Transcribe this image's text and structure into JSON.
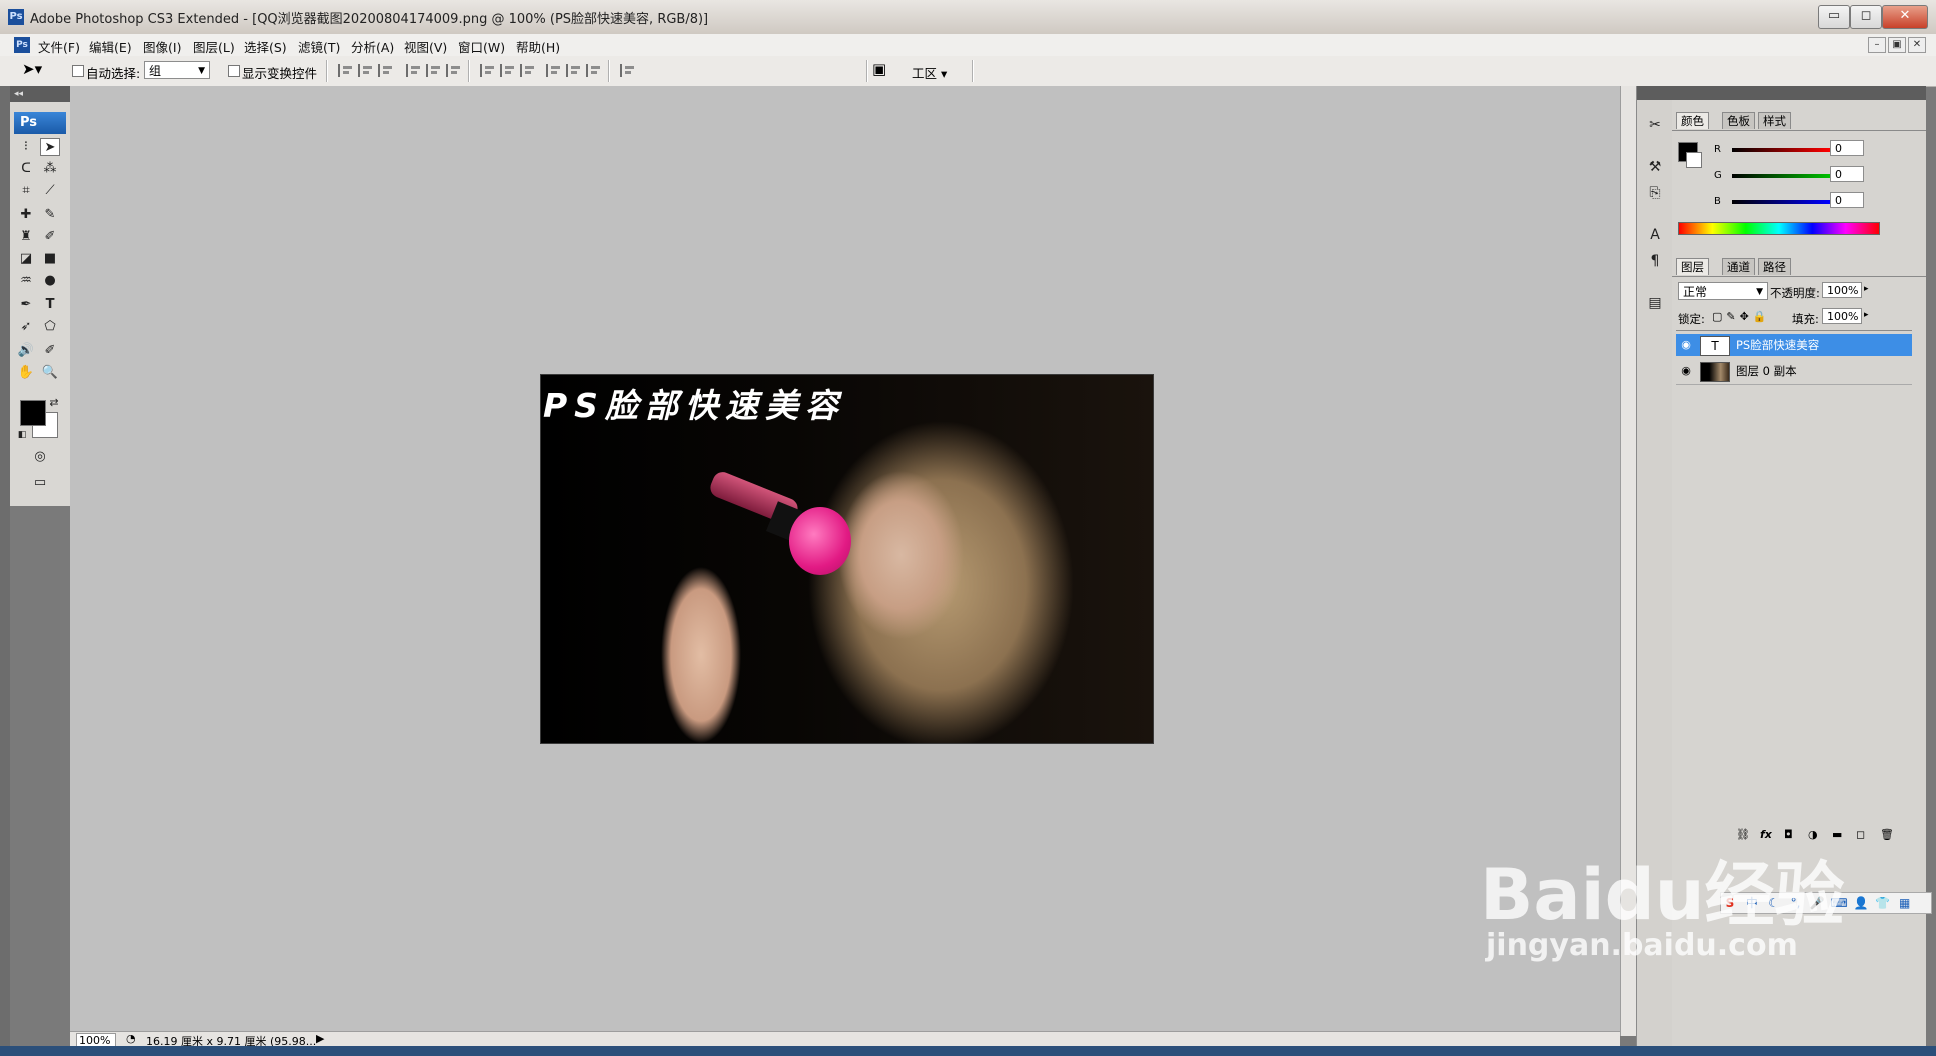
{
  "window": {
    "title": "Adobe Photoshop CS3 Extended - [QQ浏览器截图20200804174009.png @ 100% (PS脸部快速美容, RGB/8)]",
    "app_icon": "Ps",
    "controls": {
      "minimize": "▭",
      "maximize": "◻",
      "close": "✕"
    }
  },
  "menubar": {
    "items": [
      "文件(F)",
      "编辑(E)",
      "图像(I)",
      "图层(L)",
      "选择(S)",
      "滤镜(T)",
      "分析(A)",
      "视图(V)",
      "窗口(W)",
      "帮助(H)"
    ],
    "doc_controls": [
      "–",
      "▣",
      "✕"
    ]
  },
  "options": {
    "auto_select_label": "自动选择:",
    "auto_select_value": "组",
    "show_transform_label": "显示变换控件",
    "workspace_label": "工区"
  },
  "toolbox": {
    "logo": "Ps",
    "tools": [
      "move-icon",
      "marquee-icon",
      "lasso-icon",
      "magic-wand-icon",
      "crop-icon",
      "slice-icon",
      "healing-icon",
      "brush-icon",
      "stamp-icon",
      "history-brush-icon",
      "eraser-icon",
      "gradient-icon",
      "blur-icon",
      "dodge-icon",
      "pen-icon",
      "type-icon",
      "path-select-icon",
      "shape-icon",
      "notes-icon",
      "eyedropper-icon",
      "hand-icon",
      "zoom-icon"
    ]
  },
  "document": {
    "overlay_text": "PS脸部快速美容"
  },
  "statusbar": {
    "zoom": "100%",
    "doc_info": "16.19 厘米 x 9.71 厘米 (95.98..."
  },
  "panels": {
    "color_tabs": [
      "颜色",
      "色板",
      "样式"
    ],
    "channels": [
      {
        "label": "R",
        "value": "0",
        "color": "#d00000"
      },
      {
        "label": "G",
        "value": "0",
        "color": "#00b000"
      },
      {
        "label": "B",
        "value": "0",
        "color": "#0000d0"
      }
    ],
    "layer_tabs": [
      "图层",
      "通道",
      "路径"
    ],
    "blend_mode": "正常",
    "opacity_label": "不透明度:",
    "opacity_value": "100%",
    "lock_label": "锁定:",
    "fill_label": "填充:",
    "fill_value": "100%",
    "layers": [
      {
        "name": "PS脸部快速美容",
        "thumb": "T",
        "selected": true
      },
      {
        "name": "图层 0 副本",
        "thumb": "",
        "selected": false
      }
    ]
  },
  "ime": {
    "items": [
      "S",
      "中",
      "☾",
      "°,",
      "🎤",
      "⌨",
      "👤",
      "👕",
      "▦"
    ]
  },
  "watermark": {
    "line1": "Baidu经验",
    "line2": "jingyan.baidu.com"
  }
}
